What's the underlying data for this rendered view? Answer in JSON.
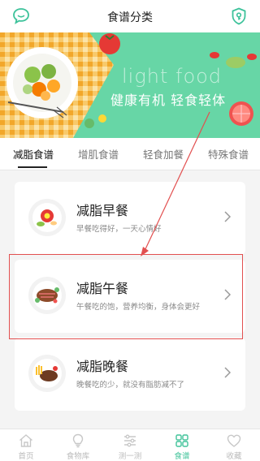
{
  "header": {
    "title": "食谱分类"
  },
  "banner": {
    "en_text": "light food",
    "slogan": "健康有机 轻食轻体"
  },
  "tabs": [
    {
      "label": "减脂食谱"
    },
    {
      "label": "增肌食谱"
    },
    {
      "label": "轻食加餐"
    },
    {
      "label": "特殊食谱"
    }
  ],
  "recipes": [
    {
      "title": "减脂早餐",
      "desc": "早餐吃得好，一天心情好"
    },
    {
      "title": "减脂午餐",
      "desc": "午餐吃的饱，营养均衡，身体会更好"
    },
    {
      "title": "减脂晚餐",
      "desc": "晚餐吃的少，就没有脂肪减不了"
    }
  ],
  "nav": [
    {
      "label": "首页",
      "icon": "home-icon"
    },
    {
      "label": "食物库",
      "icon": "bulb-icon"
    },
    {
      "label": "测一测",
      "icon": "sliders-icon"
    },
    {
      "label": "食谱",
      "icon": "grid-icon"
    },
    {
      "label": "收藏",
      "icon": "heart-icon"
    }
  ],
  "colors": {
    "accent": "#41c39a",
    "banner": "#67d6a6",
    "highlight": "#e25050"
  }
}
